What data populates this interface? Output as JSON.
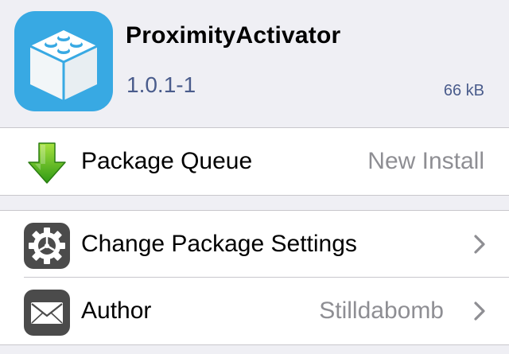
{
  "package": {
    "name": "ProximityActivator",
    "version": "1.0.1-1",
    "size": "66 kB",
    "icon": "lego-brick-icon",
    "icon_color": "#38a9e3"
  },
  "queue_row": {
    "label": "Package Queue",
    "value": "New Install",
    "icon": "green-down-arrow-icon"
  },
  "settings_rows": [
    {
      "label": "Change Package Settings",
      "value": "",
      "icon": "gear-icon"
    },
    {
      "label": "Author",
      "value": "Stilldabomb",
      "icon": "envelope-icon"
    }
  ],
  "colors": {
    "background": "#efeff4",
    "row_background": "#ffffff",
    "secondary_text": "#8e8e93",
    "detail_blue": "#4a5c8c",
    "separator": "#c8c7cc",
    "chevron": "#8e8e93"
  }
}
